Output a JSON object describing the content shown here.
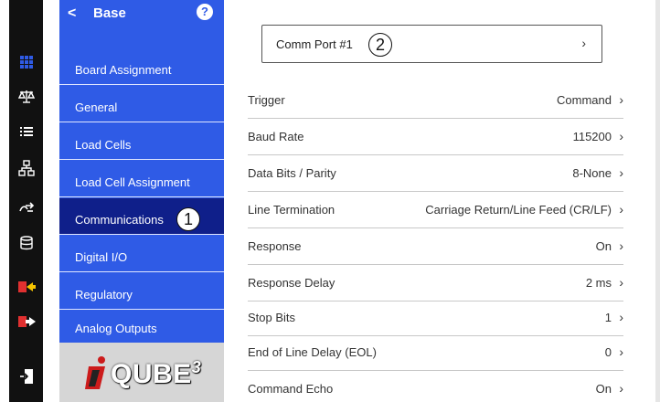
{
  "nav": {
    "title": "Base",
    "back_glyph": "<",
    "help_glyph": "?",
    "items": [
      {
        "label": "Board Assignment",
        "active": false
      },
      {
        "label": "General",
        "active": false
      },
      {
        "label": "Load Cells",
        "active": false
      },
      {
        "label": "Load Cell Assignment",
        "active": false
      },
      {
        "label": "Communications",
        "active": true
      },
      {
        "label": "Digital I/O",
        "active": false
      },
      {
        "label": "Regulatory",
        "active": false
      },
      {
        "label": "Analog Outputs",
        "active": false
      }
    ]
  },
  "rail": {
    "icons": [
      "grid-icon",
      "scale-icon",
      "list-icon",
      "network-icon",
      "transfer-icon",
      "database-icon",
      "import-icon",
      "export-icon",
      "login-icon"
    ]
  },
  "logo": {
    "text": "QUBE",
    "superscript": "3"
  },
  "callouts": {
    "one": "1",
    "two": "2"
  },
  "comm": {
    "label": "Comm Port #1",
    "chevron": "›"
  },
  "settings": [
    {
      "key": "Trigger",
      "value": "Command"
    },
    {
      "key": "Baud Rate",
      "value": "115200"
    },
    {
      "key": "Data Bits / Parity",
      "value": "8-None"
    },
    {
      "key": "Line Termination",
      "value": "Carriage Return/Line Feed (CR/LF)"
    },
    {
      "key": "Response",
      "value": "On"
    },
    {
      "key": "Response Delay",
      "value": "2 ms"
    },
    {
      "key": "Stop Bits",
      "value": "1"
    },
    {
      "key": "End of Line Delay (EOL)",
      "value": "0"
    },
    {
      "key": "Command Echo",
      "value": "On"
    }
  ],
  "colors": {
    "nav_blue": "#2f5be6",
    "nav_active": "#0f1f8a",
    "rail": "#111111"
  }
}
